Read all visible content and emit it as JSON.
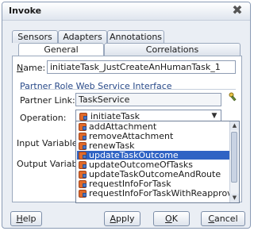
{
  "window": {
    "title": "Invoke"
  },
  "tabs": {
    "row1": [
      {
        "label": "Sensors"
      },
      {
        "label": "Adapters"
      },
      {
        "label": "Annotations"
      }
    ],
    "row2": [
      {
        "label": "General",
        "active": true
      },
      {
        "label": "Correlations",
        "active": false
      }
    ]
  },
  "form": {
    "name": {
      "label_prefix": "",
      "label_underlined": "N",
      "label_suffix": "ame:",
      "value": "initiateTask_JustCreateAnHumanTask_1"
    },
    "partner_group": {
      "title": "Partner Role Web Service Interface"
    },
    "partner_link": {
      "label": "Partner Link:",
      "value": "TaskService"
    },
    "operation": {
      "label": "Operation:",
      "value": "initiateTask"
    },
    "input_variable": {
      "label": "Input Variable"
    },
    "output_variable": {
      "label": "Output Variab"
    }
  },
  "dropdown": {
    "options": [
      {
        "label": "addAttachment",
        "selected": false
      },
      {
        "label": "removeAttachment",
        "selected": false
      },
      {
        "label": "renewTask",
        "selected": false
      },
      {
        "label": "updateTaskOutcome",
        "selected": true
      },
      {
        "label": "updateOutcomeOfTasks",
        "selected": false
      },
      {
        "label": "updateTaskOutcomeAndRoute",
        "selected": false
      },
      {
        "label": "requestInfoForTask",
        "selected": false
      },
      {
        "label": "requestInfoForTaskWithReapproval",
        "selected": false
      }
    ]
  },
  "buttons": {
    "help": {
      "underlined": "H",
      "rest": "elp"
    },
    "apply": {
      "underlined": "A",
      "rest": "pply"
    },
    "ok": {
      "underlined": "O",
      "rest": "K"
    },
    "cancel": {
      "underlined": "C",
      "rest": "ancel"
    }
  },
  "icons": {
    "close": "close-icon",
    "operation": "operation-icon",
    "partner_link_browse": "link-icon",
    "scroll_up": "scroll-up-icon",
    "scroll_down": "scroll-down-icon",
    "dropdown_arrow": "chevron-down-icon"
  },
  "colors": {
    "selection": "#2f63c4",
    "group_title": "#2a4b8a",
    "operation_icon": "#e06a2b"
  }
}
